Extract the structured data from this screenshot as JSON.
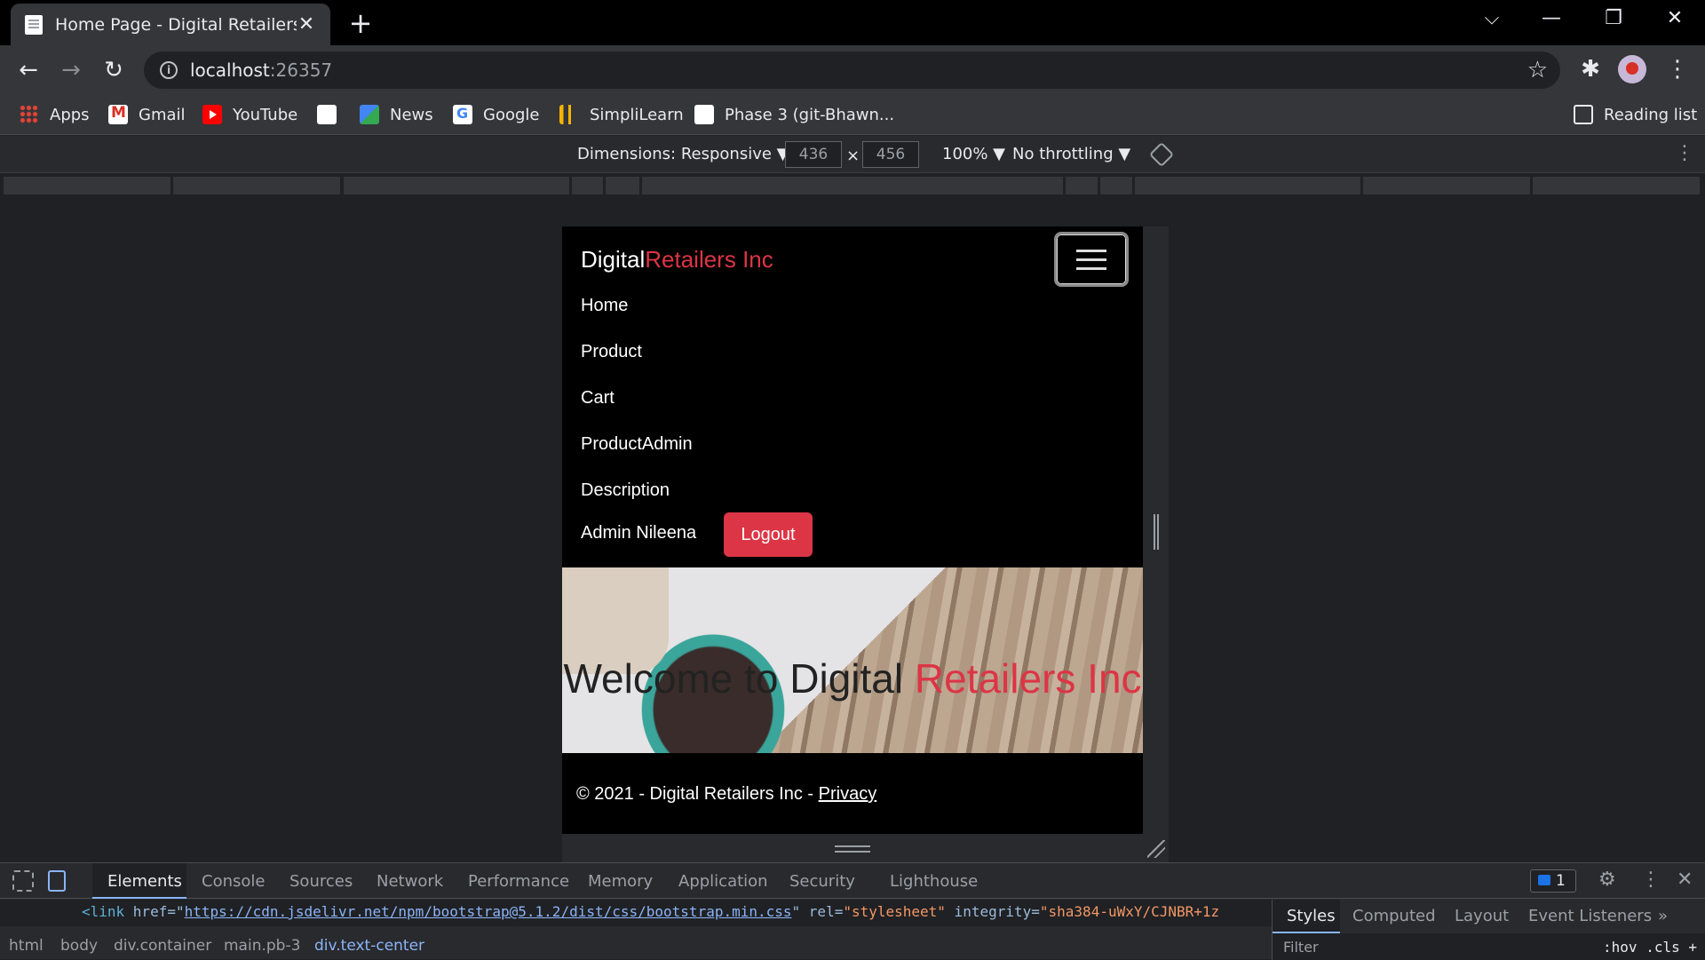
{
  "browser": {
    "tab_title": "Home Page - Digital Retailers Inc",
    "tab_close": "✕",
    "new_tab": "+",
    "win_controls": {
      "tabsearch": "⌵",
      "minimize": "—",
      "restore": "❐",
      "close": "✕"
    },
    "url_host": "localhost",
    "url_port": ":26357",
    "nav": {
      "back": "←",
      "forward": "→",
      "reload": "↻",
      "star": "☆",
      "extensions": "✱",
      "menu": "⋮"
    }
  },
  "bookmarks": [
    {
      "label": "Apps",
      "icon": "apps-grid-icon"
    },
    {
      "label": "Gmail",
      "icon": "gmail-icon"
    },
    {
      "label": "YouTube",
      "icon": "youtube-icon"
    },
    {
      "label": "",
      "icon": "globe-icon"
    },
    {
      "label": "News",
      "icon": "news-icon"
    },
    {
      "label": "Google",
      "icon": "google-icon"
    },
    {
      "label": "SimpliLearn",
      "icon": "simplilearn-icon"
    },
    {
      "label": "Phase 3 (git-Bhawn...",
      "icon": "github-icon"
    }
  ],
  "reading_list": "Reading list",
  "device_toolbar": {
    "dimensions": "Dimensions: Responsive ▼",
    "width": "436",
    "times": "×",
    "height": "456",
    "zoom": "100% ▼",
    "throttle": "No throttling ▼",
    "more": "⋮"
  },
  "site": {
    "brand_main": "Digital",
    "brand_accent": "Retailers Inc",
    "nav_links": [
      "Home",
      "Product",
      "Cart",
      "ProductAdmin",
      "Description"
    ],
    "user_label": "Admin Nileena",
    "logout_label": "Logout",
    "hero_main": "Welcome to Digital ",
    "hero_accent": "Retailers Inc",
    "footer_text": "© 2021 - Digital Retailers Inc - ",
    "footer_link": "Privacy",
    "accent_color": "#dc3545"
  },
  "devtools": {
    "tabs": [
      "Elements",
      "Console",
      "Sources",
      "Network",
      "Performance",
      "Memory",
      "Application",
      "Security",
      "Lighthouse"
    ],
    "issues_count": "1",
    "settings": "⚙",
    "kebab": "⋮",
    "close": "✕",
    "code": {
      "open": "<link ",
      "href_attr": "href=\"",
      "href_val": "https://cdn.jsdelivr.net/npm/bootstrap@5.1.2/dist/css/bootstrap.min.css",
      "rel_part": "\" rel=",
      "rel_val": "\"stylesheet\"",
      "integrity_attr": " integrity=",
      "integrity_val": "\"sha384-uWxY/CJNBR+1z"
    },
    "breadcrumbs": [
      "html",
      "body",
      "div.container",
      "main.pb-3",
      "div.text-center"
    ],
    "side_tabs": [
      "Styles",
      "Computed",
      "Layout",
      "Event Listeners",
      "»"
    ],
    "filter_placeholder": "Filter",
    "filter_tools": ":hov .cls +"
  }
}
